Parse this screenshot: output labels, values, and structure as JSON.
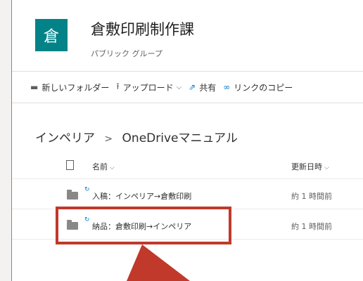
{
  "group": {
    "avatar_letter": "倉",
    "title": "倉敷印刷制作課",
    "subtitle": "パブリック グループ",
    "avatar_color": "#038387"
  },
  "commands": {
    "new_folder": "新しいフォルダー",
    "upload": "アップロード",
    "share": "共有",
    "copy_link": "リンクのコピー"
  },
  "breadcrumb": {
    "parent": "インペリア",
    "separator": ">",
    "current": "OneDriveマニュアル"
  },
  "list": {
    "columns": {
      "name": "名前",
      "modified": "更新日時"
    },
    "rows": [
      {
        "name": "入稿：インペリア→倉敷印刷",
        "modified": "約 1 時間前",
        "icon": "folder-icon"
      },
      {
        "name": "納品：倉敷印刷→インペリア",
        "modified": "約 1 時間前",
        "icon": "folder-icon"
      }
    ]
  },
  "colors": {
    "accent": "#0078d4",
    "highlight": "#c0392b"
  }
}
